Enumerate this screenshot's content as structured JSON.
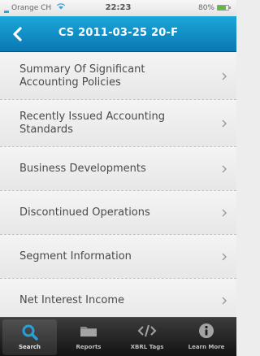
{
  "status_bar": {
    "carrier": "Orange CH",
    "time": "22:23",
    "battery": "80%"
  },
  "nav": {
    "title": "CS 2011-03-25 20-F",
    "back_icon": "back-arrow-icon"
  },
  "list": {
    "items": [
      {
        "label": "Summary Of Significant Accounting Policies"
      },
      {
        "label": "Recently Issued Accounting Standards"
      },
      {
        "label": "Business Developments"
      },
      {
        "label": "Discontinued Operations"
      },
      {
        "label": "Segment Information"
      },
      {
        "label": "Net Interest Income"
      }
    ]
  },
  "tab_bar": {
    "tabs": [
      {
        "label": "Search",
        "icon": "search-icon",
        "active": true
      },
      {
        "label": "Reports",
        "icon": "folder-icon",
        "active": false
      },
      {
        "label": "XBRL Tags",
        "icon": "code-icon",
        "active": false
      },
      {
        "label": "Learn More",
        "icon": "info-icon",
        "active": false
      }
    ]
  },
  "colors": {
    "nav_blue": "#1496cc",
    "accent_search": "#2a9fd6",
    "row_text": "#4a4a4a",
    "tab_bar": "#1e1e1e"
  }
}
